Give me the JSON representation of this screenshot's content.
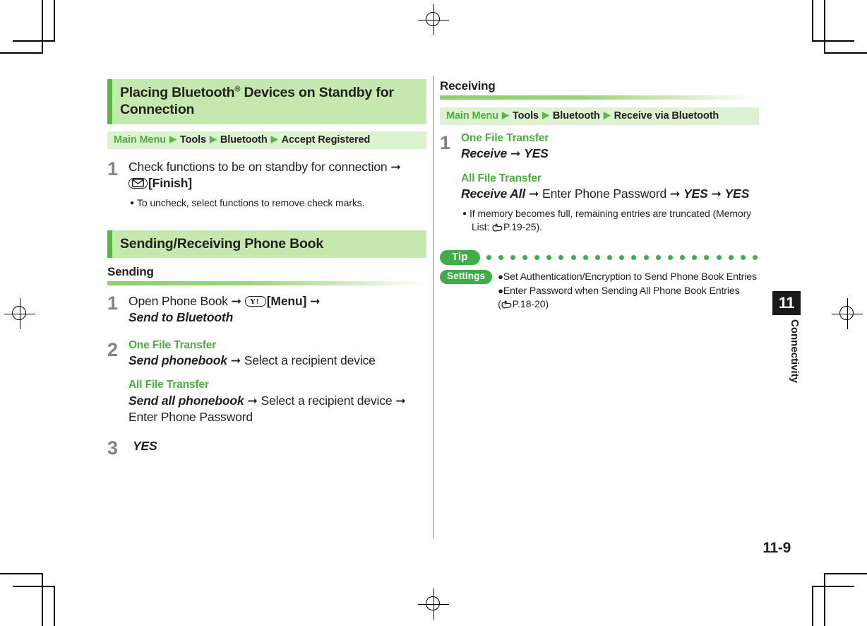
{
  "page": {
    "folio": "11-9",
    "chapter_number": "11",
    "chapter_label": "Connectivity"
  },
  "left_column": {
    "section1": {
      "heading": "Placing Bluetooth® Devices on Standby for Connection",
      "heading_main": "Placing Bluetooth",
      "heading_sup": "®",
      "heading_rest": " Devices on Standby for Connection",
      "navpath": {
        "root": "Main Menu",
        "items": [
          "Tools",
          "Bluetooth",
          "Accept Registered"
        ],
        "separator": "▶"
      },
      "steps": [
        {
          "num": "1",
          "line1_pre": "Check functions to be on standby for connection ",
          "line1_arrow": "➞",
          "key_icon": "envelope-key-icon",
          "key_label": "[Finish]",
          "note": "To uncheck, select functions to remove check marks."
        }
      ]
    },
    "section2": {
      "heading": "Sending/Receiving Phone Book",
      "subheading": "Sending",
      "steps": [
        {
          "num": "1",
          "text_pre": "Open Phone Book ",
          "arrow1": "➞",
          "key_icon": "yahoo-key-icon",
          "key_label": "[Menu]",
          "arrow2": "➞",
          "menu_item": "Send to Bluetooth"
        },
        {
          "num": "2",
          "group1_label": "One File Transfer",
          "group1_item": "Send phonebook",
          "group1_arrow": "➞",
          "group1_tail": "Select a recipient device",
          "group2_label": "All File Transfer",
          "group2_item": "Send all phonebook",
          "group2_arrow1": "➞",
          "group2_mid": "Select a recipient device",
          "group2_arrow2": "➞",
          "group2_tail": "Enter Phone Password"
        },
        {
          "num": "3",
          "menu_item": "YES"
        }
      ]
    }
  },
  "right_column": {
    "subheading": "Receiving",
    "navpath": {
      "root": "Main Menu",
      "items": [
        "Tools",
        "Bluetooth",
        "Receive via Bluetooth"
      ],
      "separator": "▶"
    },
    "steps": [
      {
        "num": "1",
        "group1_label": "One File Transfer",
        "group1_item": "Receive",
        "group1_arrow": "➞",
        "group1_item2": "YES",
        "group2_label": "All File Transfer",
        "group2_item": "Receive All",
        "group2_arrow1": "➞",
        "group2_mid": "Enter Phone Password",
        "group2_arrow2": "➞",
        "group2_item2": "YES",
        "group2_arrow3": "➞",
        "group2_item3": "YES",
        "note_line1": "If memory becomes full, remaining entries are truncated (Memory",
        "note_line2_pre": "List: ",
        "note_line2_ref": "P.19-25)."
      }
    ],
    "tip": {
      "tip_label": "Tip",
      "settings_label": "Settings",
      "line1": "Set Authentication/Encryption to Send Phone Book Entries",
      "line2": "Enter Password when Sending All Phone Book Entries",
      "line3_pre": "(",
      "line3_ref": "P.18-20)"
    }
  },
  "colors": {
    "accent_green": "#5cb647",
    "heading_band": "#c5e8ae",
    "navpath_band": "#ddf2d0",
    "label_green": "#4cae3f",
    "pill_green": "#3fae49",
    "step_num_gray": "#808285",
    "text": "#231f20"
  }
}
